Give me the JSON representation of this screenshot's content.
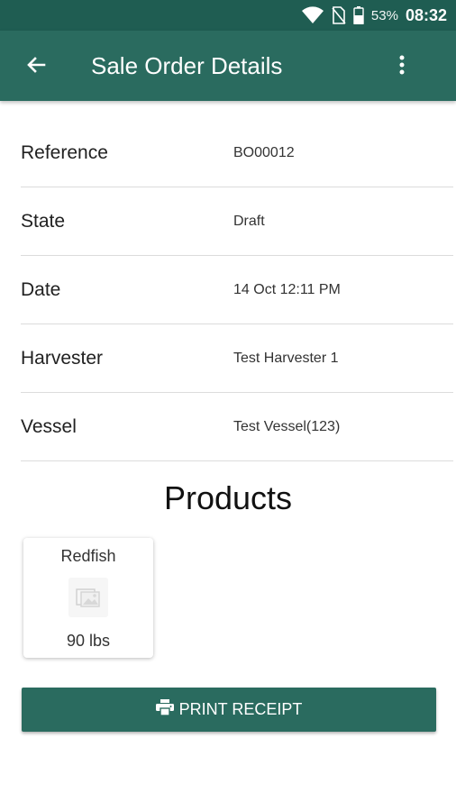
{
  "status_bar": {
    "battery_percent": "53%",
    "time": "08:32",
    "icons": [
      "wifi-icon",
      "no-sim-icon",
      "battery-icon"
    ]
  },
  "app_bar": {
    "title": "Sale Order Details",
    "icons": [
      "arrow-back-icon",
      "more-vert-icon"
    ]
  },
  "details": [
    {
      "label": "Reference",
      "value": "BO00012"
    },
    {
      "label": "State",
      "value": "Draft"
    },
    {
      "label": "Date",
      "value": "14 Oct 12:11 PM"
    },
    {
      "label": "Harvester",
      "value": "Test Harvester 1"
    },
    {
      "label": "Vessel",
      "value": "Test Vessel(123)"
    }
  ],
  "products": {
    "heading": "Products",
    "items": [
      {
        "name": "Redfish",
        "quantity": "90 lbs",
        "icon": "image-placeholder-icon"
      }
    ]
  },
  "actions": {
    "print_label": "PRINT RECEIPT",
    "print_icon": "printer-icon"
  },
  "colors": {
    "status_bar": "#1f5d52",
    "app_bar": "#2a6b5f",
    "button": "#2a6b5f"
  }
}
